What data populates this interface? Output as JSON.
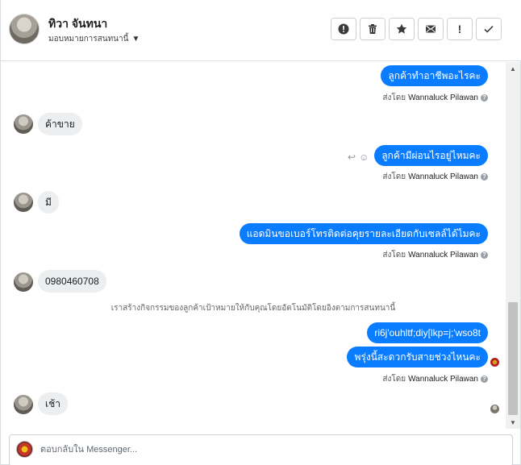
{
  "header": {
    "contact_name": "ทิวา จันทนา",
    "assign_label": "มอบหมายการสนทนานี้",
    "actions": [
      {
        "name": "spam-button",
        "icon": "alert-circle-icon"
      },
      {
        "name": "delete-button",
        "icon": "trash-icon"
      },
      {
        "name": "star-button",
        "icon": "star-icon"
      },
      {
        "name": "mark-unread-button",
        "icon": "mail-icon"
      },
      {
        "name": "follow-up-button",
        "label": "!"
      },
      {
        "name": "done-button",
        "icon": "check-icon"
      }
    ]
  },
  "conversation": {
    "sender_name": "Wannaluck Pilawan",
    "sent_by_prefix": "ส่งโดย",
    "messages": [
      {
        "dir": "out",
        "text": "ลูกค้าทำอาชีพอะไรคะ"
      },
      {
        "dir": "in",
        "text": "ค้าขาย"
      },
      {
        "dir": "out",
        "text": "ลูกค้ามีผ่อนไรอยู่ไหมคะ"
      },
      {
        "dir": "in",
        "text": "มี"
      },
      {
        "dir": "out",
        "text": "แอดมินขอเบอร์โทรติดต่อคุยรายละเอียดกับเซลล์ได้ไมคะ"
      },
      {
        "dir": "in",
        "text": "0980460708"
      },
      {
        "dir": "system",
        "text": "เราสร้างกิจกรรมของลูกค้าเป้าหมายให้กับคุณโดยอัตโนมัติโดยอิงตามการสนทนานี้"
      },
      {
        "dir": "out",
        "text": "ri6j'ouhltf;diy[lkp=j;'wso8t"
      },
      {
        "dir": "out",
        "text": "พรุ่งนี้สะดวกรับสายช่วงไหนคะ"
      },
      {
        "dir": "in",
        "text": "เช้า"
      }
    ]
  },
  "composer": {
    "placeholder": "ตอบกลับใน Messenger..."
  },
  "colors": {
    "outgoing_bubble": "#0a7cff",
    "incoming_bubble": "#eceeef"
  }
}
